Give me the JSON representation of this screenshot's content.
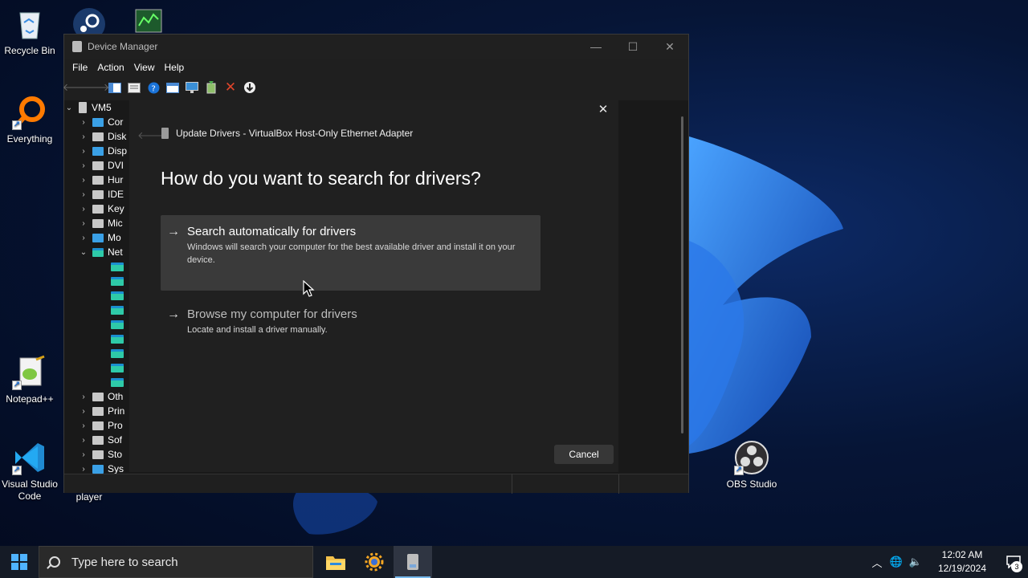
{
  "desktop": {
    "icons": [
      {
        "name": "recycle-bin",
        "label": "Recycle Bin"
      },
      {
        "name": "everything",
        "label": "Everything"
      },
      {
        "name": "notepad-plus-plus",
        "label": "Notepad++"
      },
      {
        "name": "visual-studio-code",
        "label": "Visual Studio Code"
      },
      {
        "name": "player",
        "label": "player"
      },
      {
        "name": "obs-studio",
        "label": "OBS Studio"
      }
    ]
  },
  "window": {
    "title": "Device Manager",
    "menu": [
      "File",
      "Action",
      "View",
      "Help"
    ],
    "tree": {
      "root": "VM5",
      "items": [
        {
          "label": "Cor",
          "icon": "monitor",
          "expanded": false
        },
        {
          "label": "Disk",
          "icon": "gray",
          "expanded": false
        },
        {
          "label": "Disp",
          "icon": "monitor",
          "expanded": false
        },
        {
          "label": "DVI",
          "icon": "gray",
          "expanded": false
        },
        {
          "label": "Hur",
          "icon": "gray",
          "expanded": false
        },
        {
          "label": "IDE",
          "icon": "gray",
          "expanded": false
        },
        {
          "label": "Key",
          "icon": "gray",
          "expanded": false
        },
        {
          "label": "Mic",
          "icon": "gray",
          "expanded": false
        },
        {
          "label": "Mo",
          "icon": "monitor",
          "expanded": false
        },
        {
          "label": "Net",
          "icon": "net",
          "expanded": true
        },
        {
          "label": "Oth",
          "icon": "gray",
          "expanded": false
        },
        {
          "label": "Prin",
          "icon": "gray",
          "expanded": false
        },
        {
          "label": "Pro",
          "icon": "gray",
          "expanded": false
        },
        {
          "label": "Sof",
          "icon": "gray",
          "expanded": false
        },
        {
          "label": "Sto",
          "icon": "gray",
          "expanded": false
        },
        {
          "label": "Sys",
          "icon": "monitor",
          "expanded": false
        }
      ],
      "network_children_count": 9
    }
  },
  "dialog": {
    "header": "Update Drivers - VirtualBox Host-Only Ethernet Adapter",
    "question": "How do you want to search for drivers?",
    "option_auto": {
      "title": "Search automatically for drivers",
      "desc": "Windows will search your computer for the best available driver and install it on your device."
    },
    "option_browse": {
      "title": "Browse my computer for drivers",
      "desc": "Locate and install a driver manually."
    },
    "cancel_label": "Cancel"
  },
  "taskbar": {
    "search_placeholder": "Type here to search",
    "time": "12:02 AM",
    "date": "12/19/2024",
    "notification_count": "3"
  },
  "colors": {
    "accent": "#76b9ed",
    "dialog_bg": "#202020",
    "option_highlight": "#3a3a3a"
  }
}
